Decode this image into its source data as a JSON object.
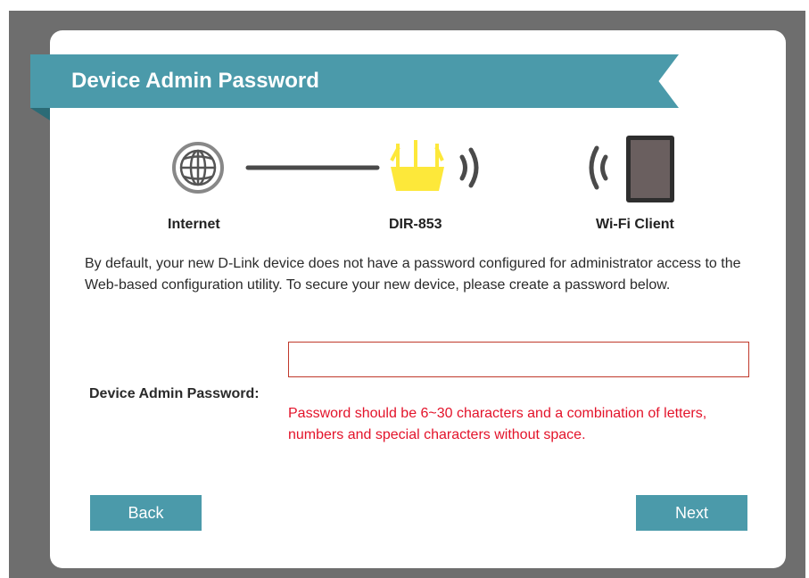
{
  "header": {
    "title": "Device Admin Password"
  },
  "topology": {
    "internet_label": "Internet",
    "router_label": "DIR-853",
    "client_label": "Wi-Fi Client"
  },
  "description": "By default, your new D-Link device does not have a password configured for administrator access to the Web-based configuration utility. To secure your new device, please create a password below.",
  "password_field": {
    "label": "Device Admin Password:",
    "value": "",
    "error": "Password should be 6~30 characters and a combination of letters, numbers and special characters without space."
  },
  "buttons": {
    "back": "Back",
    "next": "Next"
  },
  "colors": {
    "accent": "#4b9aaa",
    "router_icon": "#fde83a",
    "error": "#e3132a"
  }
}
